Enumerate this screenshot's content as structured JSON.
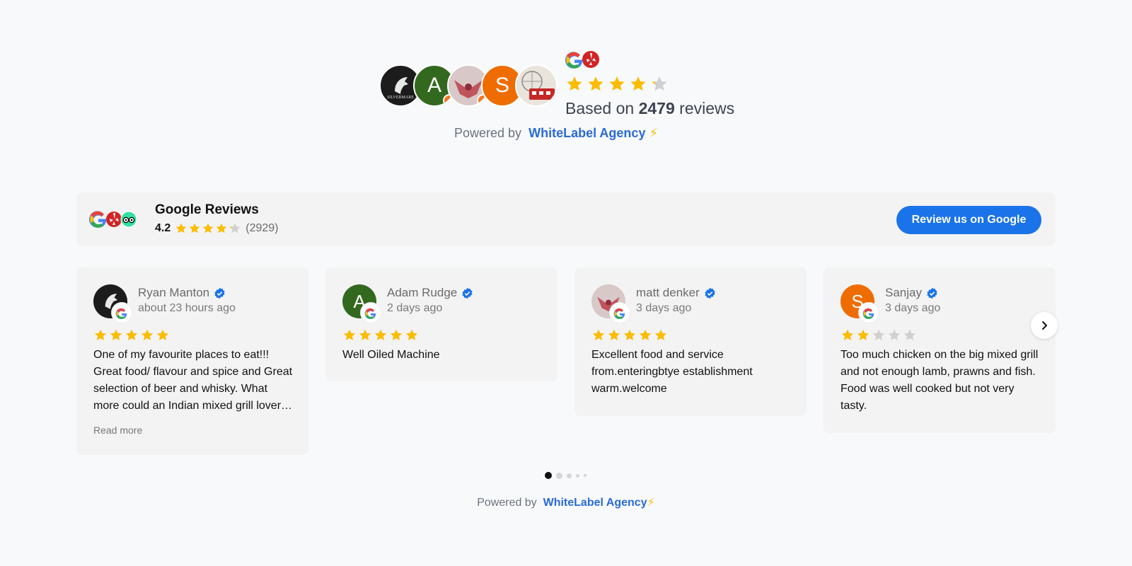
{
  "summary": {
    "rating_stars": 4.2,
    "based_on_prefix": "Based on",
    "review_count": "2479",
    "based_on_suffix": "reviews",
    "avatars": [
      {
        "kind": "logo",
        "color": "#1c1c1c",
        "letter": ""
      },
      {
        "kind": "letter",
        "color": "#33691e",
        "letter": "A"
      },
      {
        "kind": "photo",
        "color": "#d8c8c8",
        "letter": ""
      },
      {
        "kind": "letter",
        "color": "#ef6c00",
        "letter": "S"
      },
      {
        "kind": "photo",
        "color": "#e9e4dc",
        "letter": ""
      }
    ],
    "sources": [
      "google-icon",
      "yelp-icon"
    ]
  },
  "powered_top": {
    "prefix": "Powered by",
    "brand": "WhiteLabel Agency",
    "suffix": "⚡"
  },
  "header": {
    "title": "Google Reviews",
    "score": "4.2",
    "score_stars": 4.2,
    "count": "(2929)",
    "button_label": "Review us on Google",
    "sources": [
      "google-icon",
      "yelp-icon",
      "tripadvisor-icon"
    ]
  },
  "reviews": [
    {
      "name": "Ryan Manton",
      "date": "about 23 hours ago",
      "stars": 5,
      "text": "One of my favourite places to eat!!! Great food/ flavour and spice and Great selection of beer and whisky. What more could an Indian mixed grill lover ask for.",
      "read_more": "Read more",
      "avatar_color": "#1c1c1c",
      "avatar_letter": ""
    },
    {
      "name": "Adam Rudge",
      "date": "2 days ago",
      "stars": 5,
      "text": "Well Oiled Machine",
      "avatar_color": "#33691e",
      "avatar_letter": "A"
    },
    {
      "name": "matt denker",
      "date": "3 days ago",
      "stars": 5,
      "text": "Excellent food and service from.enteringbtye establishment warm.welcome",
      "avatar_color": "#d8c8c8",
      "avatar_letter": ""
    },
    {
      "name": "Sanjay",
      "date": "3 days ago",
      "stars": 2,
      "text": "Too much chicken on the big mixed grill and not enough lamb, prawns and fish. Food was well cooked but not very tasty.",
      "avatar_color": "#ef6c00",
      "avatar_letter": "S"
    }
  ],
  "pagination": {
    "total": 5,
    "active": 0
  },
  "powered_bottom": {
    "prefix": "Powered by",
    "brand": "WhiteLabel Agency",
    "suffix": "⚡"
  },
  "colors": {
    "star": "#fbbc04",
    "star_empty": "#d0d0d0",
    "accent": "#1a73e8",
    "verified": "#1a73e8"
  }
}
